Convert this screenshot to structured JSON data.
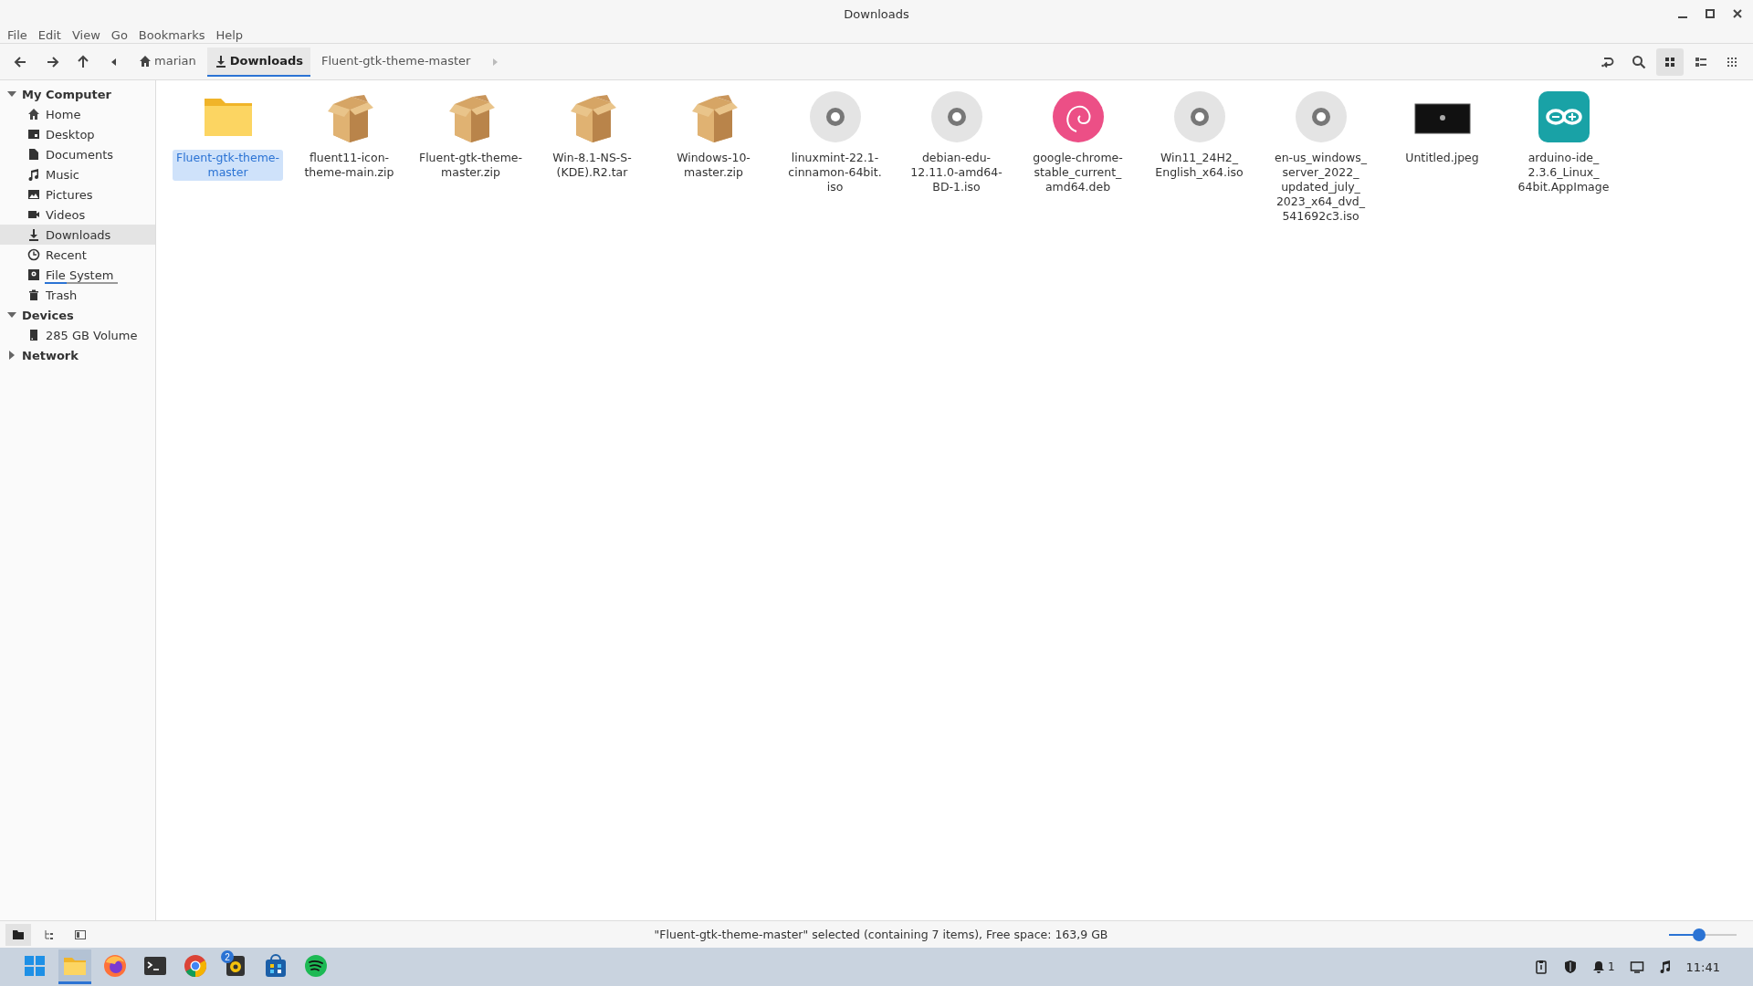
{
  "window": {
    "title": "Downloads"
  },
  "menu": [
    "File",
    "Edit",
    "View",
    "Go",
    "Bookmarks",
    "Help"
  ],
  "breadcrumbs": [
    {
      "label": "marian",
      "kind": "home",
      "selected": false
    },
    {
      "label": "Downloads",
      "kind": "downloads",
      "selected": true
    },
    {
      "label": "Fluent-gtk-theme-master",
      "kind": "plain",
      "selected": false
    }
  ],
  "view_modes": [
    {
      "kind": "icons",
      "selected": true
    },
    {
      "kind": "list",
      "selected": false
    },
    {
      "kind": "compact",
      "selected": false
    }
  ],
  "sidebar": [
    {
      "label": "My Computer",
      "expanded": true,
      "children": [
        {
          "label": "Home",
          "kind": "home",
          "selected": false
        },
        {
          "label": "Desktop",
          "kind": "desktop",
          "selected": false
        },
        {
          "label": "Documents",
          "kind": "documents",
          "selected": false
        },
        {
          "label": "Music",
          "kind": "music",
          "selected": false
        },
        {
          "label": "Pictures",
          "kind": "pictures",
          "selected": false
        },
        {
          "label": "Videos",
          "kind": "videos",
          "selected": false
        },
        {
          "label": "Downloads",
          "kind": "downloads",
          "selected": true
        },
        {
          "label": "Recent",
          "kind": "recent",
          "selected": false
        },
        {
          "label": "File System",
          "kind": "filesystem",
          "selected": false,
          "level": 0.3
        },
        {
          "label": "Trash",
          "kind": "trash",
          "selected": false
        }
      ]
    },
    {
      "label": "Devices",
      "expanded": true,
      "children": [
        {
          "label": "285 GB Volume",
          "kind": "drive",
          "selected": false
        }
      ]
    },
    {
      "label": "Network",
      "expanded": false
    }
  ],
  "files": [
    {
      "lines": [
        "Fluent-gtk-theme-",
        "master"
      ],
      "kind": "folder",
      "selected": true
    },
    {
      "lines": [
        "fluent11-icon-",
        "theme-main.zip"
      ],
      "kind": "archive",
      "selected": false
    },
    {
      "lines": [
        "Fluent-gtk-theme-",
        "master.zip"
      ],
      "kind": "archive",
      "selected": false
    },
    {
      "lines": [
        "Win-8.1-NS-S-",
        "(KDE).R2.tar"
      ],
      "kind": "archive",
      "selected": false
    },
    {
      "lines": [
        "Windows-10-",
        "master.zip"
      ],
      "kind": "archive",
      "selected": false
    },
    {
      "lines": [
        "linuxmint-22.1-",
        "cinnamon-64bit.",
        "iso"
      ],
      "kind": "disc",
      "selected": false
    },
    {
      "lines": [
        "debian-edu-",
        "12.11.0-amd64-",
        "BD-1.iso"
      ],
      "kind": "disc",
      "selected": false
    },
    {
      "lines": [
        "google-chrome-",
        "stable_current_",
        "amd64.deb"
      ],
      "kind": "package",
      "selected": false
    },
    {
      "lines": [
        "Win11_24H2_",
        "English_x64.iso"
      ],
      "kind": "disc",
      "selected": false
    },
    {
      "lines": [
        "en-us_windows_",
        "server_2022_",
        "updated_july_",
        "2023_x64_dvd_",
        "541692c3.iso"
      ],
      "kind": "disc",
      "selected": false
    },
    {
      "lines": [
        "Untitled.jpeg"
      ],
      "kind": "image",
      "selected": false
    },
    {
      "lines": [
        "arduino-ide_",
        "2.3.6_Linux_",
        "64bit.AppImage"
      ],
      "kind": "appimage",
      "selected": false
    }
  ],
  "status_bar": {
    "text": "\"Fluent-gtk-theme-master\" selected (containing 7 items), Free space: 163,9 GB",
    "zoom": {
      "level": 0.45
    }
  },
  "taskbar": {
    "apps": [
      {
        "kind": "start",
        "active": false
      },
      {
        "kind": "files",
        "active": true
      },
      {
        "kind": "firefox",
        "active": false
      },
      {
        "kind": "terminal",
        "active": false
      },
      {
        "kind": "chrome",
        "active": false
      },
      {
        "kind": "player",
        "active": false,
        "badge": "2"
      },
      {
        "kind": "store",
        "active": false
      },
      {
        "kind": "spotify",
        "active": false
      }
    ],
    "notifications": "1",
    "clock": "11:41"
  }
}
